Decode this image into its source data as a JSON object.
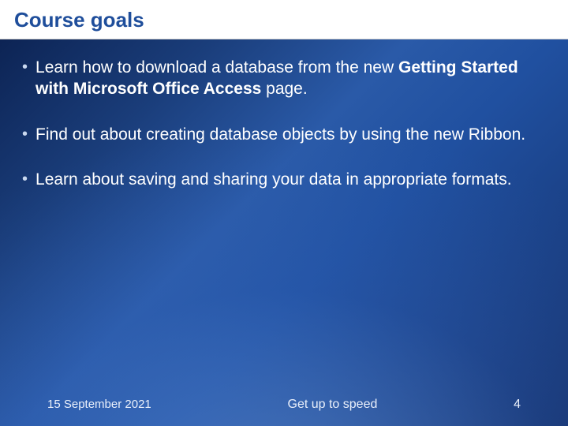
{
  "header": {
    "title": "Course goals"
  },
  "bullets": {
    "b1_pre": "Learn how to download a database from the new ",
    "b1_bold": "Getting Started with Microsoft Office Access",
    "b1_post": " page.",
    "b2": "Find out about creating database objects by using the new Ribbon.",
    "b3": "Learn about saving and sharing your data in appropriate formats."
  },
  "footer": {
    "date": "15 September 2021",
    "title": "Get up to speed",
    "page": "4"
  }
}
